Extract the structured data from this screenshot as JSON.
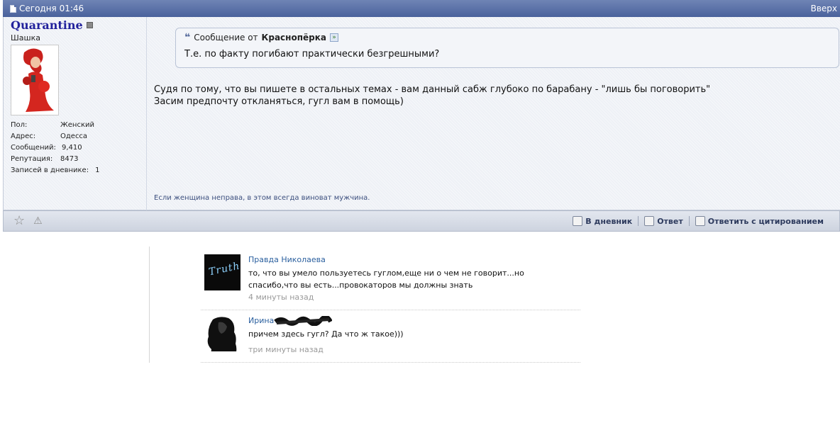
{
  "post": {
    "date": "Сегодня 01:46",
    "top_link": "Вверх"
  },
  "user": {
    "name": "Quarantine",
    "title": "Шашка",
    "stats": [
      {
        "label": "Пол:",
        "value": "Женский"
      },
      {
        "label": "Адрес:",
        "value": "Одесса"
      },
      {
        "label": "Сообщений:",
        "value": "9,410"
      },
      {
        "label": "Репутация:",
        "value": "8473"
      },
      {
        "label": "Записей в дневнике:",
        "value": "1"
      }
    ]
  },
  "quote": {
    "prefix": "Сообщение от",
    "author": "Краснопёрка",
    "text": "Т.е. по факту погибают практически безгрешными?"
  },
  "message": {
    "line1": "Судя по тому, что вы пишете в остальных темах - вам данный сабж глубоко по барабану - \"лишь бы поговорить\"",
    "line2": "Засим предпочту откланяться, гугл вам в помощь)"
  },
  "signature": "Если женщина неправа, в этом всегда виноват мужчина.",
  "actions": {
    "diary": "В дневник",
    "reply": "Ответ",
    "quote_reply": "Ответить с цитированием"
  },
  "comments": [
    {
      "name": "Правда Николаева",
      "avatar_text": "Truth",
      "text": "то, что вы умело пользуетесь гуглом,еще ни о чем не говорит...но спасибо,что вы есть...провокаторов мы должны знать",
      "time": "4 минуты назад"
    },
    {
      "name": "Ирина",
      "text": "причем здесь гугл? Да что ж такое)))",
      "time": "три минуты назад"
    }
  ]
}
